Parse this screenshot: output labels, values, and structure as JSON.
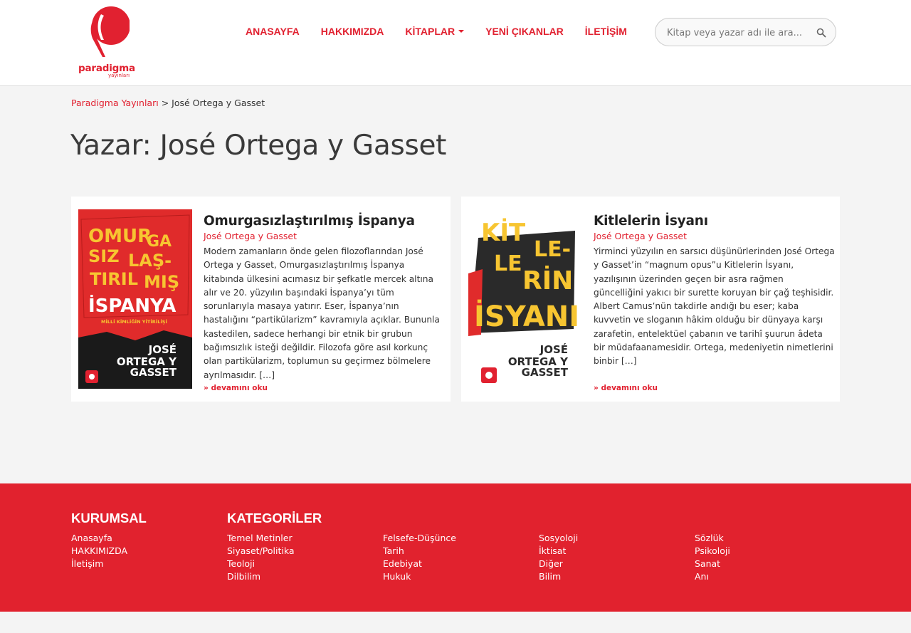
{
  "brand": {
    "name": "paradigma",
    "sub": "yayınları",
    "color": "#e12130"
  },
  "nav": [
    {
      "label": "ANASAYFA"
    },
    {
      "label": "HAKKIMIZDA"
    },
    {
      "label": "KİTAPLAR",
      "dropdown": true
    },
    {
      "label": "YENİ ÇIKANLAR"
    },
    {
      "label": "İLETİŞİM"
    }
  ],
  "search": {
    "placeholder": "Kitap veya yazar adı ile ara...",
    "icon": "search-icon"
  },
  "breadcrumb": {
    "home": "Paradigma Yayınları",
    "separator": ">",
    "current": "José Ortega y Gasset"
  },
  "page_title": "Yazar: José Ortega y Gasset",
  "books": [
    {
      "title": "Omurgasızlaştırılmış İspanya",
      "author": "José Ortega y Gasset",
      "excerpt": "Modern zamanların önde gelen filozoflarından José Ortega y Gasset, Omurgasızlaştırılmış İspanya kitabında ülkesini acımasız bir şefkatle mercek altına alır ve 20. yüzyılın başındaki İspanya’yı tüm sorunlarıyla masaya yatırır. Eser, İspanya’nın hastalığını “partikülarizm” kavramıyla açıklar. Bununla kastedilen, sadece herhangi bir etnik bir grubun bağımsızlık isteği değildir. Filozofa göre asıl korkunç olan partikülarizm, toplumun su geçirmez bölmelere ayrılmasıdır. […]",
      "read_more": "» devamını oku",
      "cover": {
        "background": "#e02b2b",
        "title_lines": [
          "OMUR",
          "GA",
          "SIZ",
          "LAŞ-",
          "TIRIL",
          "MIŞ",
          "İSPANYA"
        ],
        "subtitle": "MİLLİ KİMLİĞİN YİTİRİLİŞİ",
        "author_lines": [
          "JOSÉ",
          "ORTEGA Y",
          "GASSET"
        ]
      }
    },
    {
      "title": "Kitlelerin İsyanı",
      "author": "José Ortega y Gasset",
      "excerpt": "Yirminci yüzyılın en sarsıcı düşünürlerinden José Ortega y Gasset’in “magnum opus”u Kitlelerin İsyanı, yazılışının üzerinden geçen bir asra rağmen güncelliğini yakıcı bir surette koruyan bir çağ teşhisidir. Albert Camus’nün takdirle andığı bu eser; kaba kuvvetin ve sloganın hâkim olduğu bir dünyaya karşı zarafetin, entelektüel çabanın ve tarihî şuurun âdeta bir müdafaanamesidir. Ortega, medeniyetin nimetlerini binbir […]",
      "read_more": "» devamını oku",
      "cover": {
        "background": "#ffffff",
        "title_lines": [
          "KİT",
          "LE-",
          "LE",
          "RİN",
          "İSYANI"
        ],
        "author_lines": [
          "JOSÉ",
          "ORTEGA Y",
          "GASSET"
        ]
      }
    }
  ],
  "footer": {
    "kurumsal": {
      "heading": "KURUMSAL",
      "links": [
        "Anasayfa",
        "HAKKIMIZDA",
        "İletişim"
      ]
    },
    "kategoriler": {
      "heading": "KATEGORİLER",
      "columns": [
        [
          "Temel Metinler",
          "Siyaset/Politika",
          "Teoloji",
          "Dilbilim"
        ],
        [
          "Felsefe-Düşünce",
          "Tarih",
          "Edebiyat",
          "Hukuk"
        ],
        [
          "Sosyoloji",
          "İktisat",
          "Diğer",
          "Bilim"
        ],
        [
          "Sözlük",
          "Psikoloji",
          "Sanat",
          "Anı"
        ]
      ]
    },
    "background": "#e1222e"
  }
}
